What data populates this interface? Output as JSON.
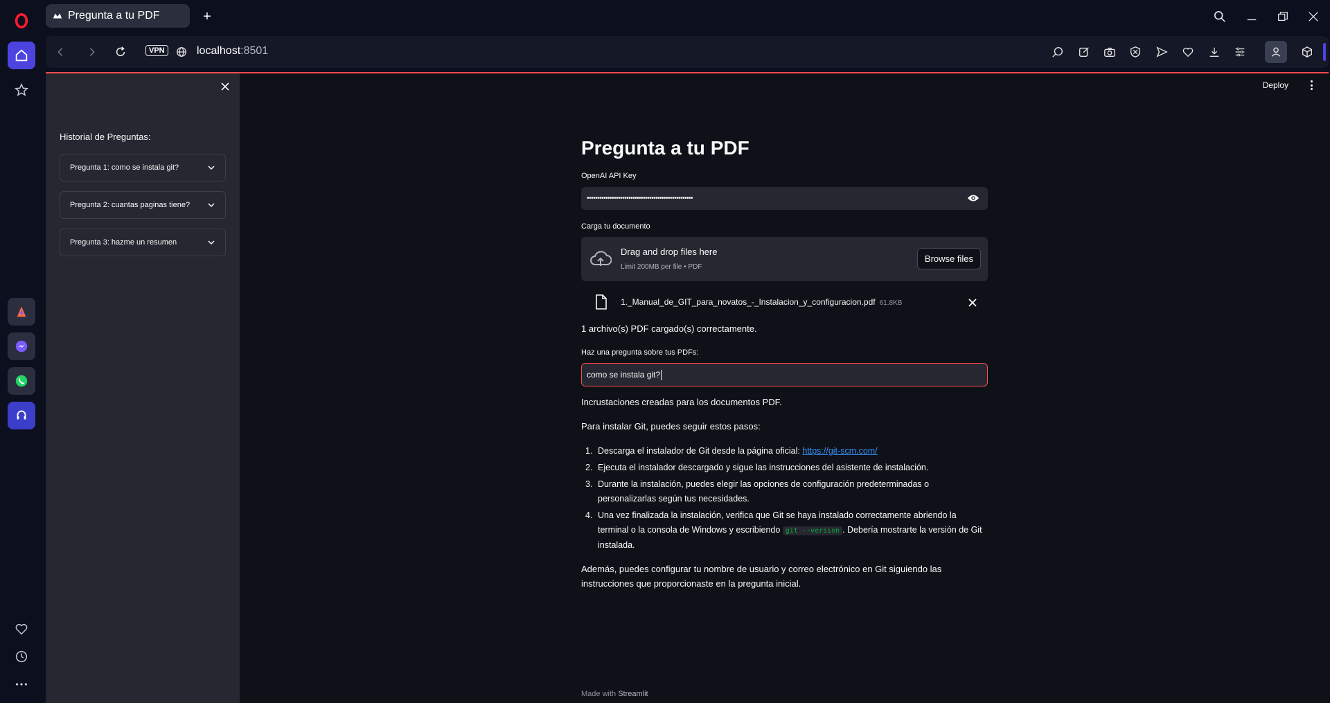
{
  "browser": {
    "tab_title": "Pregunta a tu PDF",
    "new_tab": "+",
    "vpn_label": "VPN",
    "url_host": "localhost",
    "url_port": ":8501",
    "accent": "#4d44e0"
  },
  "rail": {
    "apps": [
      "aria-icon",
      "messenger-icon",
      "whatsapp-icon",
      "music-player-icon"
    ],
    "bottom": [
      "heart-icon",
      "history-icon",
      "more-icon"
    ]
  },
  "app": {
    "deploy_label": "Deploy",
    "sidebar": {
      "title": "Historial de Preguntas:",
      "items": [
        {
          "label": "Pregunta 1: como se instala git?"
        },
        {
          "label": "Pregunta 2: cuantas paginas tiene?"
        },
        {
          "label": "Pregunta 3: hazme un resumen"
        }
      ]
    },
    "title": "Pregunta a tu PDF",
    "api_key": {
      "label": "OpenAI API Key",
      "masked_value": "•••••••••••••••••••••••••••••••••••••••••••••••••••"
    },
    "upload": {
      "label": "Carga tu documento",
      "drop_title": "Drag and drop files here",
      "drop_sub": "Limit 200MB per file • PDF",
      "browse_label": "Browse files",
      "file_name": "1._Manual_de_GIT_para_novatos_-_Instalacion_y_configuracion.pdf",
      "file_size": "61.8KB"
    },
    "status": "1 archivo(s) PDF cargado(s) correctamente.",
    "question": {
      "label": "Haz una pregunta sobre tus PDFs:",
      "value": "como se instala git?"
    },
    "embeddings_msg": "Incrustaciones creadas para los documentos PDF.",
    "answer": {
      "intro": "Para instalar Git, puedes seguir estos pasos:",
      "step1_text": "Descarga el instalador de Git desde la página oficial: ",
      "step1_link": "https://git-scm.com/",
      "step2": "Ejecuta el instalador descargado y sigue las instrucciones del asistente de instalación.",
      "step3": "Durante la instalación, puedes elegir las opciones de configuración predeterminadas o personalizarlas según tus necesidades.",
      "step4_pre": "Una vez finalizada la instalación, verifica que Git se haya instalado correctamente abriendo la terminal o la consola de Windows y escribiendo ",
      "step4_code": "git --version",
      "step4_post": ". Debería mostrarte la versión de Git instalada.",
      "outro": "Además, puedes configurar tu nombre de usuario y correo electrónico en Git siguiendo las instrucciones que proporcionaste en la pregunta inicial.",
      "nums": [
        "1.",
        "2.",
        "3.",
        "4."
      ]
    },
    "footer_prefix": "Made with ",
    "footer_brand": "Streamlit"
  }
}
